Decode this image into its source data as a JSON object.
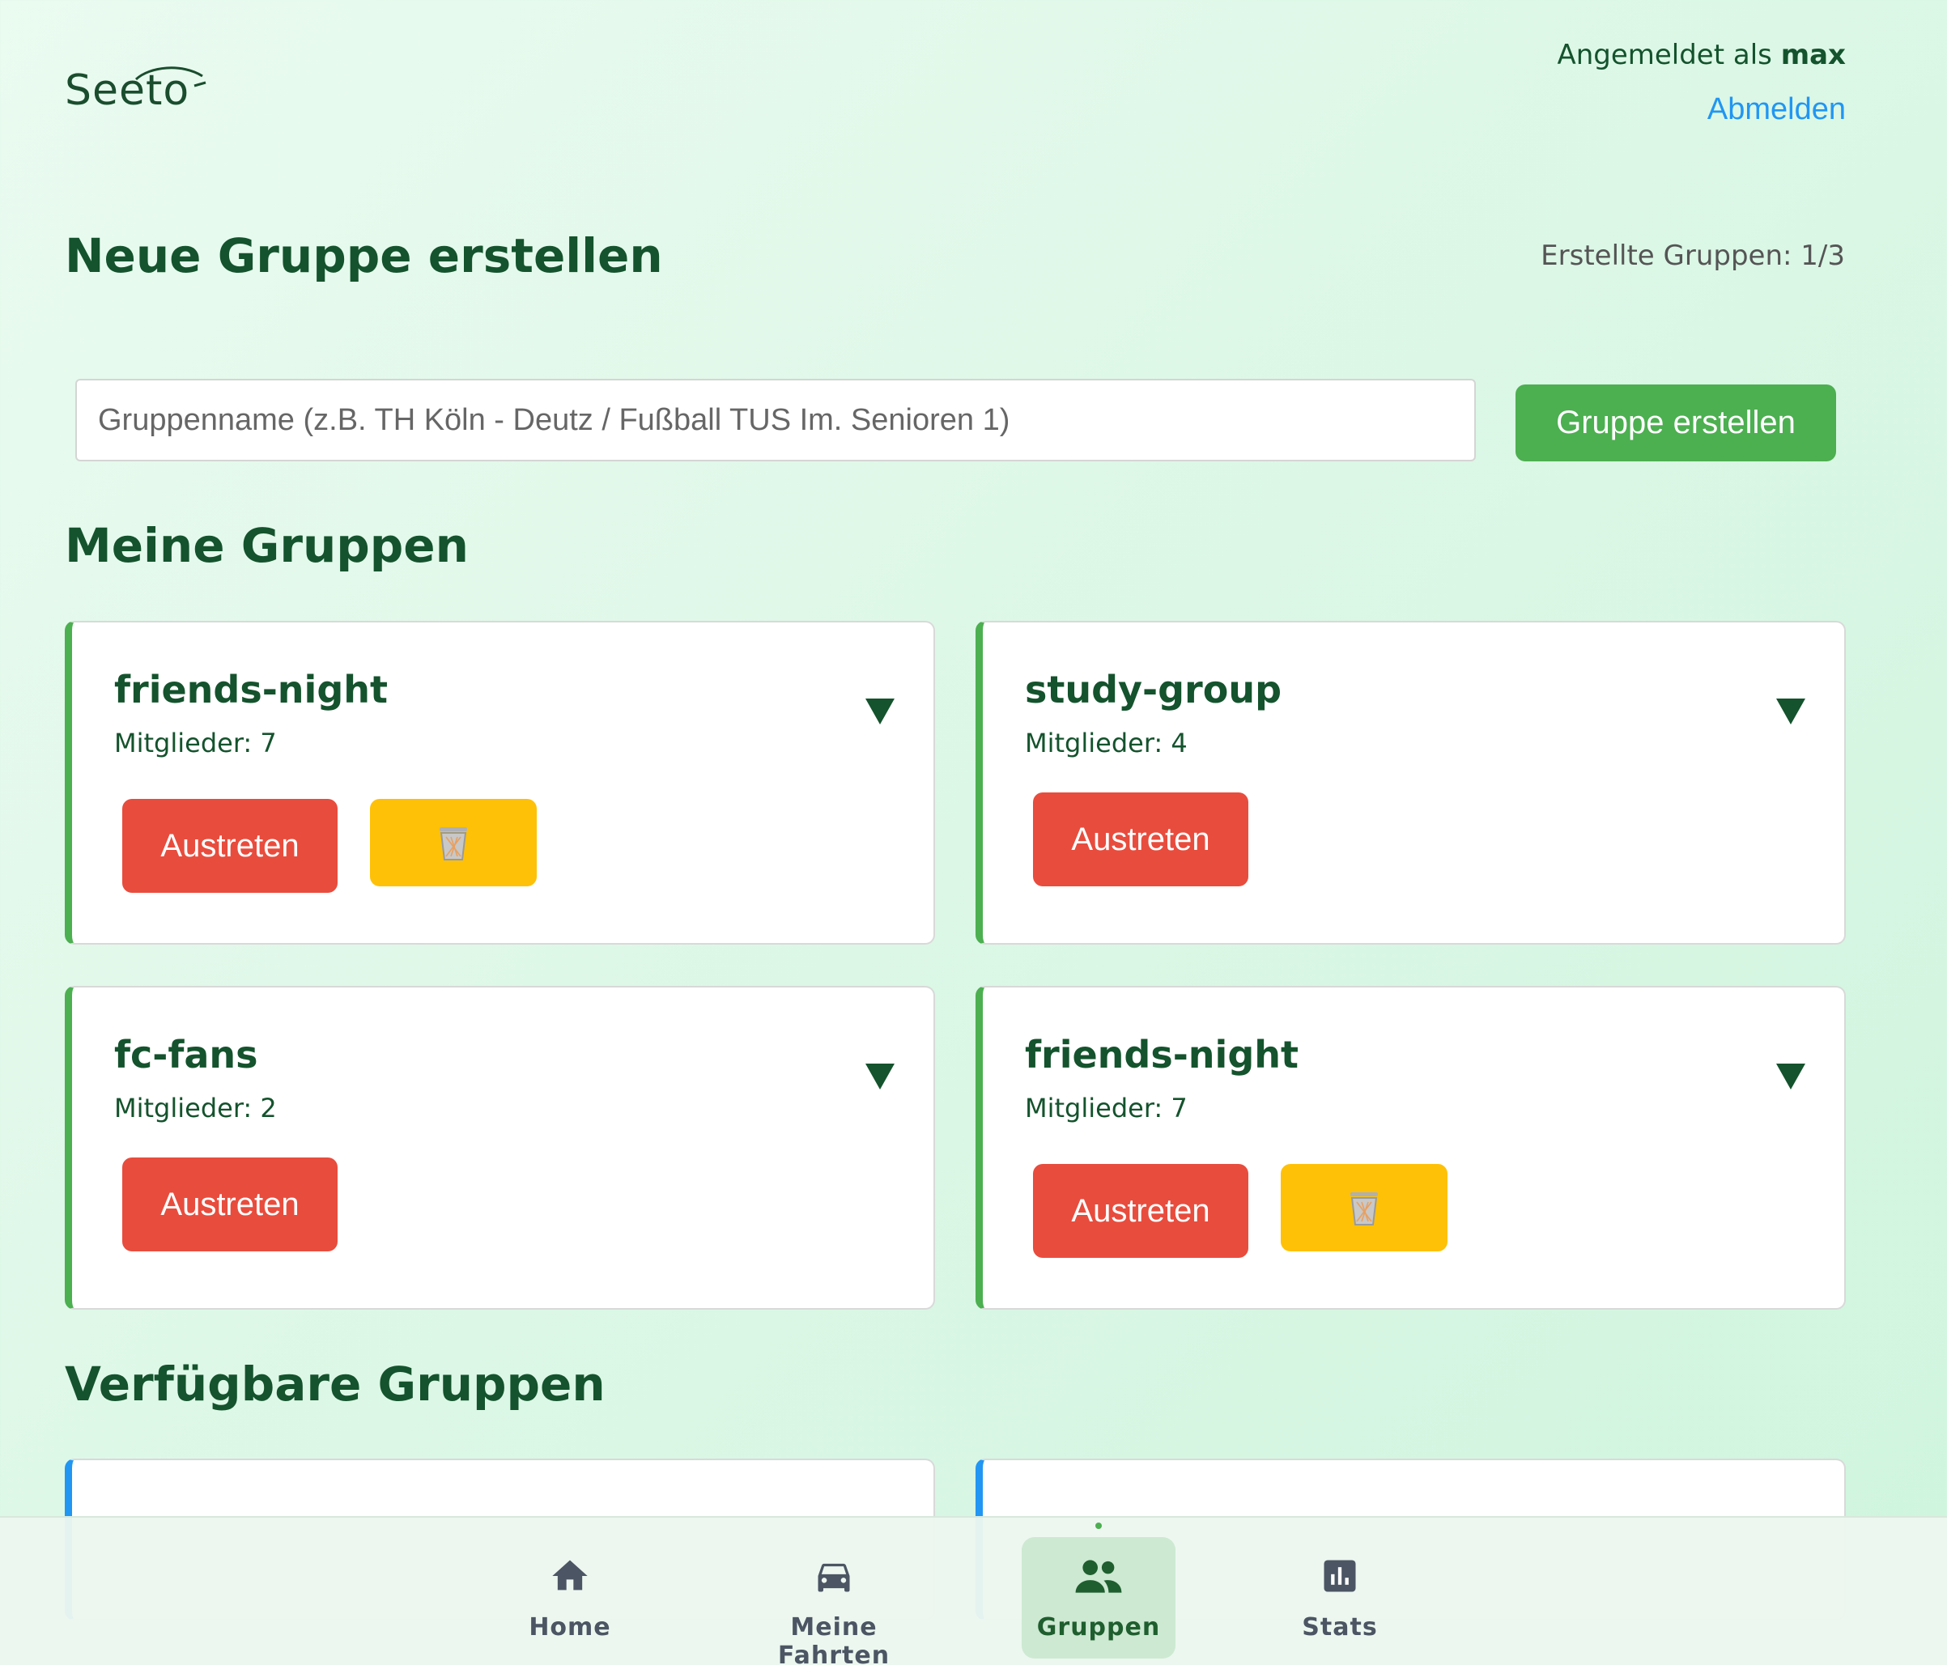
{
  "header": {
    "logo_text": "Seeto",
    "logged_in_prefix": "Angemeldet als",
    "username": "max",
    "logout_label": "Abmelden"
  },
  "create": {
    "heading": "Neue Gruppe erstellen",
    "created_count": "Erstellte Gruppen: 1/3",
    "placeholder": "Gruppenname (z.B. TH Köln - Deutz / Fußball TUS Im. Senioren 1)",
    "button_label": "Gruppe erstellen"
  },
  "my_groups": {
    "heading": "Meine Gruppen",
    "leave_label": "Austreten",
    "groups": [
      {
        "name": "friends-night",
        "members": "Mitglieder: 7",
        "deletable": true
      },
      {
        "name": "study-group",
        "members": "Mitglieder: 4",
        "deletable": false
      },
      {
        "name": "fc-fans",
        "members": "Mitglieder: 2",
        "deletable": false
      },
      {
        "name": "friends-night",
        "members": "Mitglieder: 7",
        "deletable": true
      }
    ]
  },
  "available_groups": {
    "heading": "Verfügbare Gruppen"
  },
  "bottom_nav": {
    "items": [
      {
        "label": "Home",
        "icon": "home-icon"
      },
      {
        "label": "Meine Fahrten",
        "icon": "car-icon"
      },
      {
        "label": "Gruppen",
        "icon": "group-icon",
        "active": true
      },
      {
        "label": "Stats",
        "icon": "stats-icon"
      }
    ]
  },
  "colors": {
    "primary_green": "#4caf50",
    "dark_green": "#14532d",
    "danger": "#e84c3d",
    "warning": "#ffc107",
    "link_blue": "#2196f3"
  }
}
